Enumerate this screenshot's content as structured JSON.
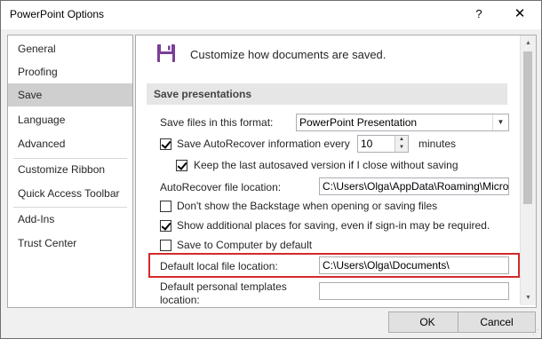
{
  "window": {
    "title": "PowerPoint Options",
    "help_symbol": "?",
    "close_symbol": "✕"
  },
  "nav": {
    "items": [
      {
        "label": "General"
      },
      {
        "label": "Proofing"
      },
      {
        "label": "Save"
      },
      {
        "label": "Language"
      },
      {
        "label": "Advanced"
      },
      {
        "label": "Customize Ribbon"
      },
      {
        "label": "Quick Access Toolbar"
      },
      {
        "label": "Add-Ins"
      },
      {
        "label": "Trust Center"
      }
    ],
    "selected": "Save"
  },
  "content": {
    "header": {
      "icon": "save-disk-icon",
      "text": "Customize how documents are saved."
    },
    "section_title": "Save presentations",
    "format": {
      "label": "Save files in this format:",
      "value": "PowerPoint Presentation"
    },
    "autorecover": {
      "checked": true,
      "label": "Save AutoRecover information every",
      "value": "10",
      "unit": "minutes"
    },
    "keep_last": {
      "checked": true,
      "label": "Keep the last autosaved version if I close without saving"
    },
    "ar_location": {
      "label": "AutoRecover file location:",
      "value": "C:\\Users\\Olga\\AppData\\Roaming\\Micro"
    },
    "no_backstage": {
      "checked": false,
      "label": "Don't show the Backstage when opening or saving files"
    },
    "additional_places": {
      "checked": true,
      "label": "Show additional places for saving, even if sign-in may be required."
    },
    "save_computer": {
      "checked": false,
      "label": "Save to Computer by default"
    },
    "default_local": {
      "label": "Default local file location:",
      "value": "C:\\Users\\Olga\\Documents\\"
    },
    "personal_templates": {
      "label_line1": "Default personal templates",
      "label_line2": "location:",
      "value": ""
    }
  },
  "buttons": {
    "ok": "OK",
    "cancel": "Cancel"
  },
  "colors": {
    "icon_purple": "#7b3f98",
    "highlight_red": "#d42a2a",
    "selected_nav": "#cfcfcf"
  }
}
